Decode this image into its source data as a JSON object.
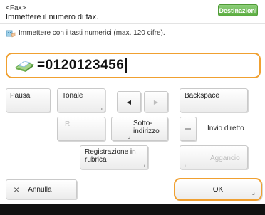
{
  "header": {
    "mode": "<Fax>",
    "instruction": "Immettere il numero di fax."
  },
  "destinations_button": "Destinazioni",
  "hint": "Immettere con i tasti numerici (max. 120 cifre).",
  "fax_number": "=0120123456",
  "keys": {
    "pause": "Pausa",
    "tone": "Tonale",
    "left_arrow": "◀",
    "right_arrow": "▶",
    "backspace": "Backspace",
    "r": "R",
    "subaddress_line1": "Sotto-",
    "subaddress_line2": "indirizzo",
    "direct_send": "Invio diretto",
    "register_line1": "Registrazione in",
    "register_line2": "rubrica",
    "hook": "Aggancio"
  },
  "footer": {
    "cancel_icon": "×",
    "cancel": "Annulla",
    "ok": "OK"
  },
  "icons": {
    "hint": "keypad-hand-icon",
    "fax": "fax-icon",
    "cancel": "close-icon"
  },
  "colors": {
    "accent_orange": "#f0a030",
    "destinations_green": "#6cbc52"
  }
}
